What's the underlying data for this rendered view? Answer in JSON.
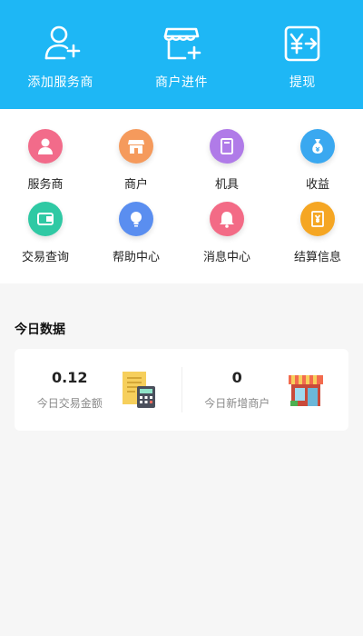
{
  "header": {
    "items": [
      {
        "label": "添加服务商",
        "icon": "add-user-icon"
      },
      {
        "label": "商户进件",
        "icon": "store-add-icon"
      },
      {
        "label": "提现",
        "icon": "withdraw-icon"
      }
    ]
  },
  "grid": {
    "items": [
      {
        "label": "服务商",
        "icon": "person-icon",
        "color": "#f26b8a"
      },
      {
        "label": "商户",
        "icon": "store-icon",
        "color": "#f59a5c"
      },
      {
        "label": "机具",
        "icon": "device-icon",
        "color": "#b07be8"
      },
      {
        "label": "收益",
        "icon": "money-bag-icon",
        "color": "#3aa8f0"
      },
      {
        "label": "交易查询",
        "icon": "wallet-icon",
        "color": "#2fc9a4"
      },
      {
        "label": "帮助中心",
        "icon": "bulb-icon",
        "color": "#5a8ef0"
      },
      {
        "label": "消息中心",
        "icon": "bell-icon",
        "color": "#f36b86"
      },
      {
        "label": "结算信息",
        "icon": "bill-icon",
        "color": "#f5a623"
      }
    ]
  },
  "today": {
    "title": "今日数据",
    "stats": [
      {
        "value": "0.12",
        "label": "今日交易金额",
        "icon": "receipt-calculator-icon"
      },
      {
        "value": "0",
        "label": "今日新增商户",
        "icon": "shop-icon"
      }
    ]
  }
}
